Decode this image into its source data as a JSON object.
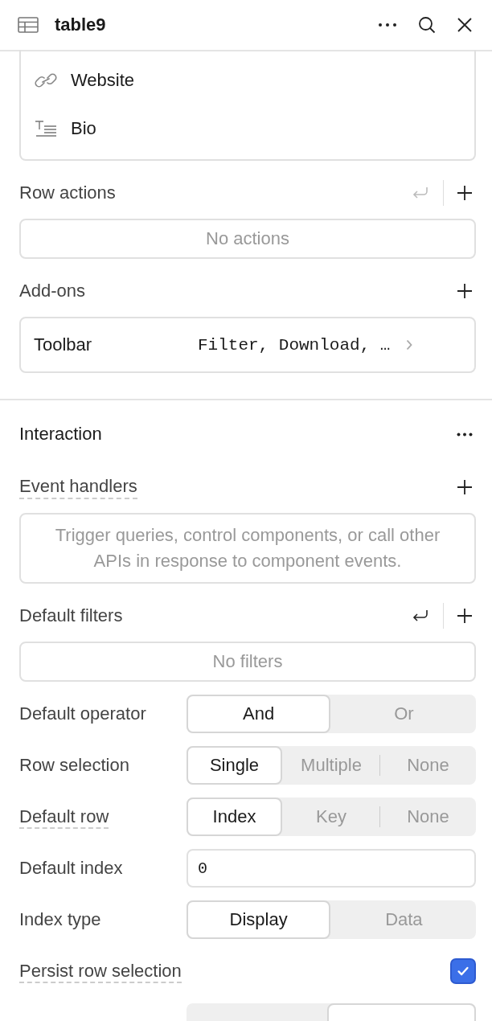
{
  "header": {
    "title": "table9"
  },
  "columns": [
    {
      "kind": "link",
      "label": "Website"
    },
    {
      "kind": "text",
      "label": "Bio"
    }
  ],
  "row_actions": {
    "label": "Row actions",
    "reset_disabled": true,
    "empty_text": "No actions"
  },
  "add_ons": {
    "label": "Add-ons",
    "items": [
      {
        "label": "Toolbar",
        "value": "Filter, Download, …"
      }
    ]
  },
  "interaction": {
    "title": "Interaction",
    "event_handlers": {
      "label": "Event handlers",
      "hint": true,
      "empty_text": "Trigger queries, control components, or call other APIs in response to component events."
    },
    "default_filters": {
      "label": "Default filters",
      "reset_disabled": false,
      "empty_text": "No filters"
    },
    "settings": [
      {
        "kind": "segmented",
        "label": "Default operator",
        "hint": false,
        "options": [
          {
            "label": "And",
            "selected": true
          },
          {
            "label": "Or",
            "selected": false
          }
        ]
      },
      {
        "kind": "segmented",
        "label": "Row selection",
        "hint": false,
        "options": [
          {
            "label": "Single",
            "selected": true
          },
          {
            "label": "Multiple",
            "selected": false
          },
          {
            "label": "None",
            "selected": false
          }
        ]
      },
      {
        "kind": "segmented",
        "label": "Default row",
        "hint": true,
        "options": [
          {
            "label": "Index",
            "selected": true
          },
          {
            "label": "Key",
            "selected": false
          },
          {
            "label": "None",
            "selected": false
          }
        ]
      },
      {
        "kind": "input",
        "label": "Default index",
        "hint": false,
        "value": "0"
      },
      {
        "kind": "segmented",
        "label": "Index type",
        "hint": false,
        "options": [
          {
            "label": "Display",
            "selected": true
          },
          {
            "label": "Data",
            "selected": false
          }
        ]
      },
      {
        "kind": "checkbox",
        "label": "Persist row selection",
        "hint": true,
        "checked": true
      },
      {
        "kind": "segmented",
        "options": [
          {
            "selected": false
          },
          {
            "selected": true
          }
        ]
      }
    ]
  }
}
